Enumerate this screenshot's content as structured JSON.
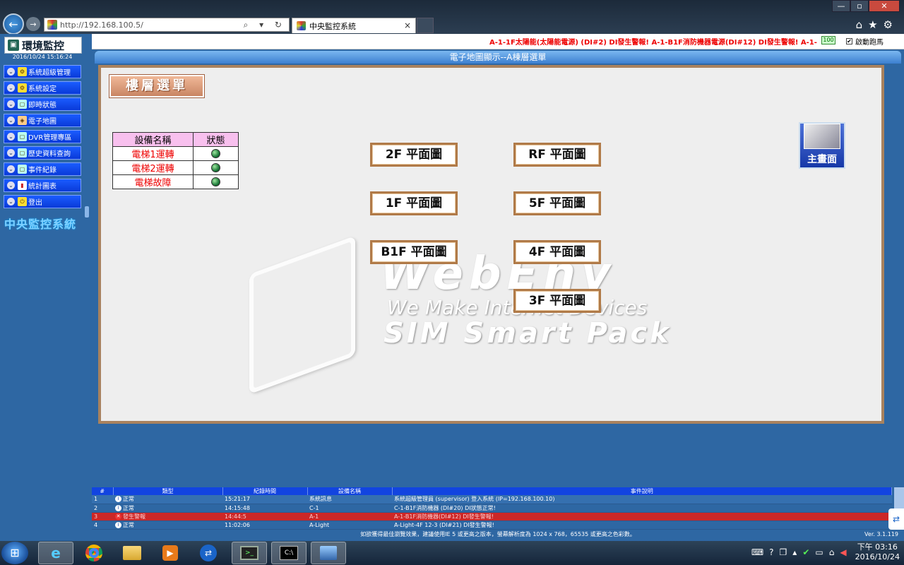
{
  "browser": {
    "url": "http://192.168.100.5/",
    "tab_title": "中央監控系統",
    "back_glyph": "←",
    "forward_glyph": "→",
    "address_tools": "⌕ ▾ ↻",
    "tab_close": "×",
    "right_icons": "⌂★⚙",
    "window_buttons": {
      "minimize": "—",
      "maximize": "▫",
      "close": "✕"
    }
  },
  "alarm_strip": {
    "text": "A-1-1F太陽能(太陽能電源) (DI#2) DI發生警報!   A-1-B1F消防機器電源(DI#12) DI發生警報!   A-1-",
    "battery": "100",
    "auto_scroll_label": "啟動跑馬"
  },
  "sidebar": {
    "logo_title": "環境監控",
    "datetime": "2016/10/24 15:16:24",
    "items": [
      {
        "label": "系統超級管理"
      },
      {
        "label": "系統設定"
      },
      {
        "label": "即時狀態"
      },
      {
        "label": "電子地圖"
      },
      {
        "label": "DVR管理專區"
      },
      {
        "label": "歷史資料查詢"
      },
      {
        "label": "事件紀錄"
      },
      {
        "label": "統計圖表"
      },
      {
        "label": "登出"
      }
    ],
    "system_title": "中央監控系統"
  },
  "content": {
    "title": "電子地圖顯示--A棟層選單",
    "floor_menu_header": "樓層選單",
    "device_table": {
      "headers": [
        "設備名稱",
        "狀態"
      ],
      "rows": [
        {
          "name": "電梯1運轉"
        },
        {
          "name": "電梯2運轉"
        },
        {
          "name": "電梯故障"
        }
      ]
    },
    "floors_left": [
      "2F 平面圖",
      "1F 平面圖",
      "B1F 平面圖"
    ],
    "floors_right": [
      "RF 平面圖",
      "5F 平面圖",
      "4F 平面圖",
      "3F 平面圖"
    ],
    "home_button_label": "主畫面",
    "watermark": {
      "line1": "WebEnv",
      "line2": "We Make Internet Devices",
      "line3": "SIM Smart Pack"
    }
  },
  "event_log": {
    "headers": [
      "#",
      "類型",
      "紀錄時間",
      "設備名稱",
      "事件說明"
    ],
    "rows": [
      {
        "num": "1",
        "type": "正常",
        "time": "15:21:17",
        "device": "系統訊息",
        "desc": "系統超級管理員 (supervisor) 登入系統 (IP=192.168.100.10)"
      },
      {
        "num": "2",
        "type": "正常",
        "time": "14:15:48",
        "device": "C-1",
        "desc": "C-1-B1F消防機器 (DI#20) DI狀態正常!"
      },
      {
        "num": "3",
        "type": "發生警報",
        "time": "14:44:5",
        "device": "A-1",
        "desc": "A-1-B1F消防機器(DI#12) DI發生警報!"
      },
      {
        "num": "4",
        "type": "正常",
        "time": "11:02:06",
        "device": "A-Light",
        "desc": "A-Light-4F 12-3 (DI#21) DI發生警報!"
      }
    ]
  },
  "footer": {
    "note": "如欲獲得最佳瀏覽效果，建議使用IE 5 或更高之版本，螢幕解析度為 1024 x 768，65535 或更高之色彩數。",
    "version": "Ver. 3.1.119"
  },
  "taskbar": {
    "time": "下午 03:16",
    "date": "2016/10/24",
    "apps": [
      "ie-icon",
      "chrome-icon",
      "explorer-icon",
      "media-player-icon",
      "teamviewer-icon",
      "terminal-icon",
      "cmd-icon",
      "network-icon"
    ]
  }
}
